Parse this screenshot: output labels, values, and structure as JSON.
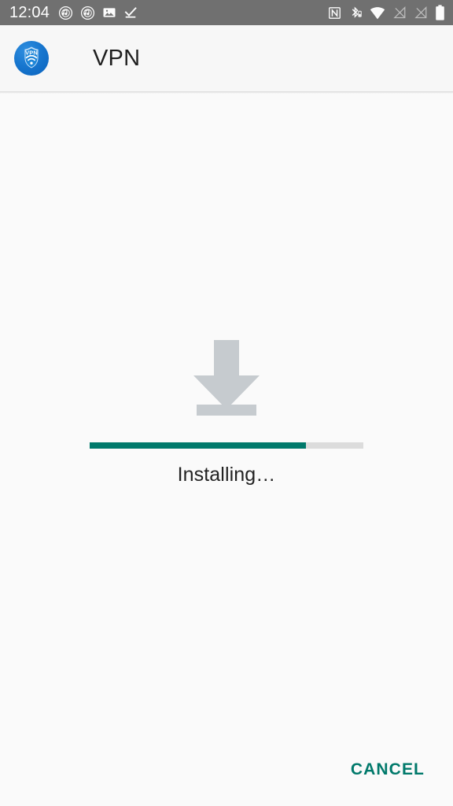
{
  "status_bar": {
    "clock": "12:04",
    "background_color": "#707070",
    "foreground_color": "#ffffff",
    "left_icons": [
      {
        "name": "music-note-circle-icon",
        "label": "Music"
      },
      {
        "name": "music-note-circle-icon",
        "label": "Music"
      },
      {
        "name": "image-icon",
        "label": "Screenshot"
      },
      {
        "name": "download-complete-icon",
        "label": "Download complete"
      }
    ],
    "right_icons": [
      {
        "name": "nfc-icon",
        "label": "NFC"
      },
      {
        "name": "bluetooth-battery-icon",
        "label": "Bluetooth"
      },
      {
        "name": "wifi-icon",
        "label": "Wi-Fi"
      },
      {
        "name": "signal-off-icon",
        "label": "No SIM 1"
      },
      {
        "name": "signal-off-icon",
        "label": "No SIM 2"
      },
      {
        "name": "battery-icon",
        "label": "Battery"
      }
    ]
  },
  "app_bar": {
    "icon_name": "vpn-shield-icon",
    "icon_text": "VPN",
    "title": "VPN",
    "background_color": "#f7f7f7"
  },
  "main": {
    "download_icon_name": "download-arrow-icon",
    "progress": {
      "percent": 79,
      "fill_color": "#00796b",
      "track_color": "#dcdcdc"
    },
    "status_text": "Installing…"
  },
  "bottom_bar": {
    "cancel_label": "CANCEL",
    "accent_color": "#00796b"
  }
}
